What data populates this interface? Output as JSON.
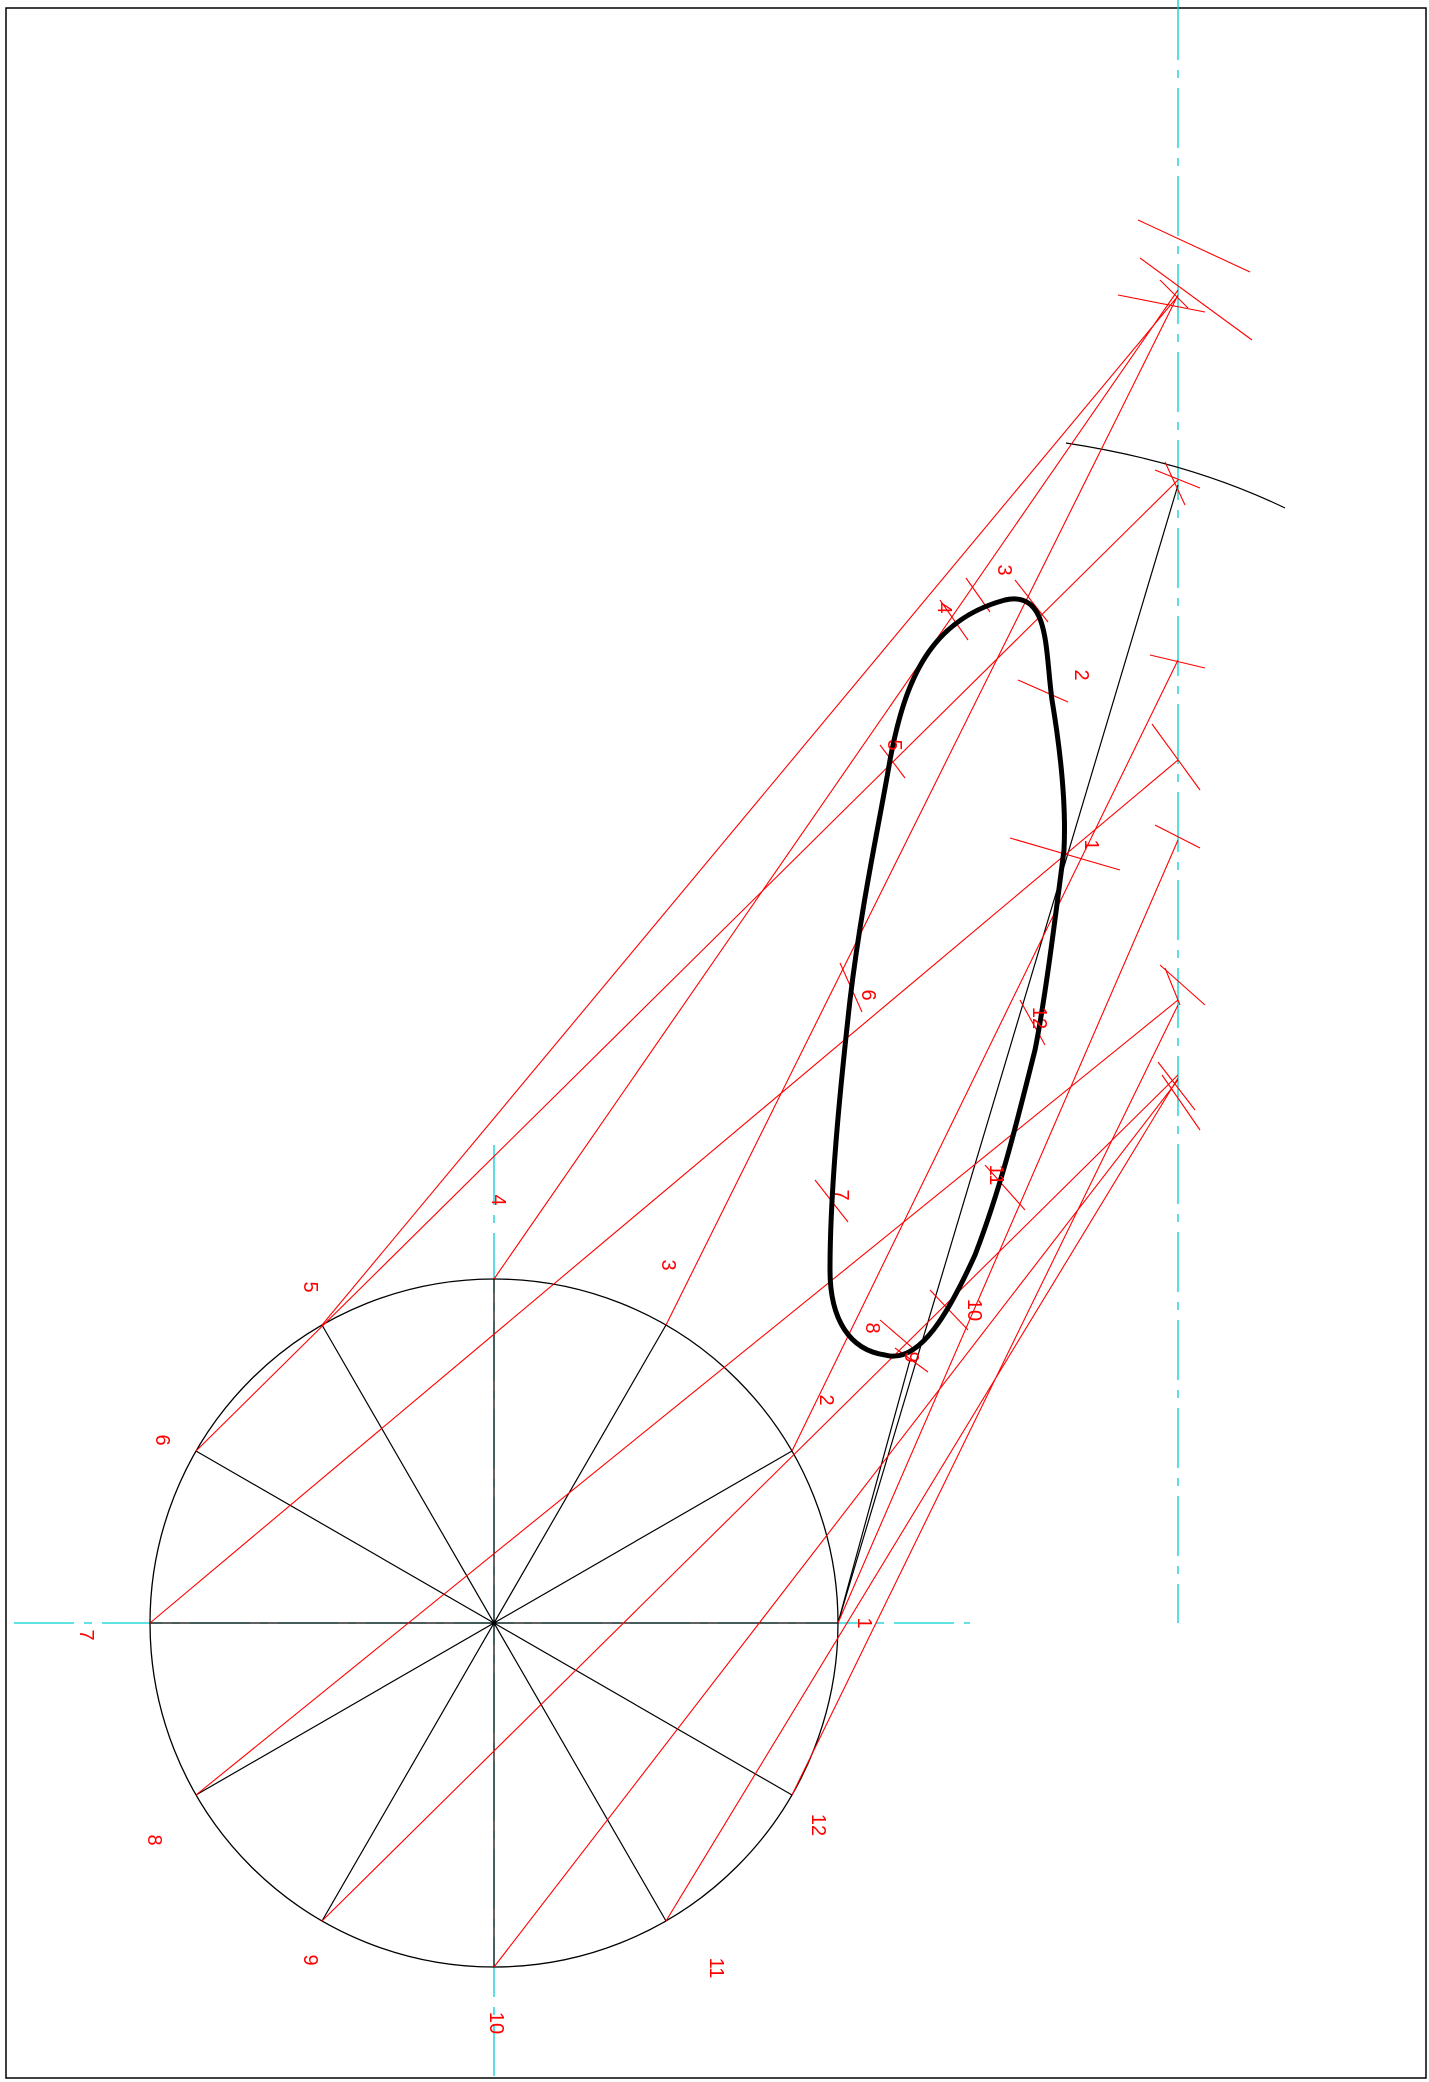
{
  "colors": {
    "construction": "#ff0000",
    "outline": "#000000",
    "centerline": "#00d0d0",
    "background": "#ffffff"
  },
  "circle_labels": [
    "1",
    "2",
    "3",
    "4",
    "5",
    "6",
    "7",
    "8",
    "9",
    "10",
    "11",
    "12"
  ],
  "curve_labels": [
    "1",
    "2",
    "3",
    "4",
    "5",
    "6",
    "7",
    "8",
    "9",
    "10",
    "11",
    "12"
  ]
}
